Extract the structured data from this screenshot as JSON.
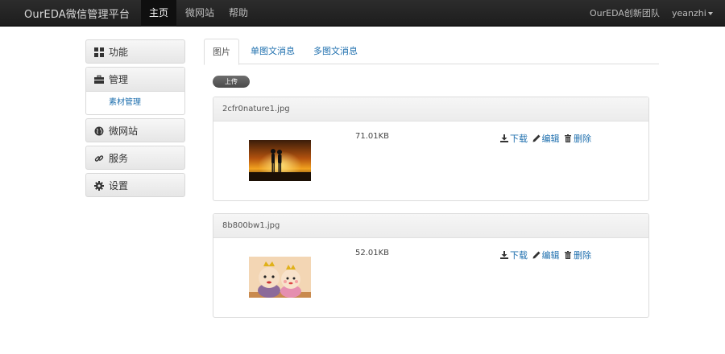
{
  "navbar": {
    "brand": "OurEDA微信管理平台",
    "items": [
      "主页",
      "微网站",
      "帮助"
    ],
    "active_index": 0,
    "right_team": "OurEDA创新团队",
    "user": "yeanzhi"
  },
  "sidebar": {
    "items": [
      {
        "label": "功能",
        "icon": "grid-icon"
      },
      {
        "label": "管理",
        "icon": "briefcase-icon",
        "sub": [
          "素材管理"
        ]
      },
      {
        "label": "微网站",
        "icon": "globe-icon"
      },
      {
        "label": "服务",
        "icon": "link-icon"
      },
      {
        "label": "设置",
        "icon": "gear-icon"
      }
    ]
  },
  "tabs": [
    "图片",
    "单图文消息",
    "多图文消息"
  ],
  "active_tab": 0,
  "upload_label": "上传",
  "files": [
    {
      "name": "2cfr0nature1.jpg",
      "size": "71.01KB",
      "thumb": "sunset-couple"
    },
    {
      "name": "8b800bw1.jpg",
      "size": "52.01KB",
      "thumb": "plush-dolls"
    }
  ],
  "actions": {
    "download": "下载",
    "edit": "编辑",
    "delete": "删除"
  },
  "colors": {
    "link": "#1e6fae",
    "navbar": "#222222"
  }
}
